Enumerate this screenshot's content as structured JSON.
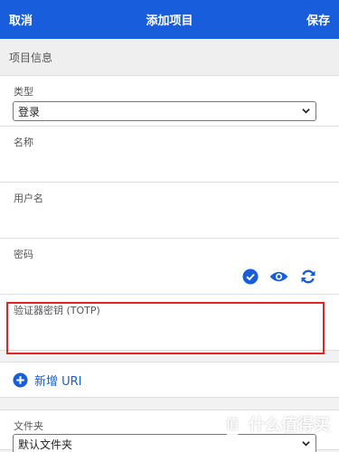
{
  "header": {
    "cancel": "取消",
    "title": "添加项目",
    "save": "保存"
  },
  "section": {
    "title": "项目信息"
  },
  "fields": {
    "type_label": "类型",
    "type_value": "登录",
    "name_label": "名称",
    "username_label": "用户名",
    "password_label": "密码",
    "totp_label": "验证器密钥 (TOTP)"
  },
  "uri": {
    "add_label": "新增 URI"
  },
  "folder": {
    "label": "文件夹",
    "value": "默认文件夹"
  },
  "colors": {
    "accent": "#175ddc",
    "highlight": "#e32424"
  },
  "icons": [
    "check-circle-icon",
    "eye-icon",
    "refresh-icon",
    "plus-circle-icon",
    "chevron-down-icon"
  ],
  "watermark": {
    "text": "什么值得买",
    "mark": "值"
  }
}
